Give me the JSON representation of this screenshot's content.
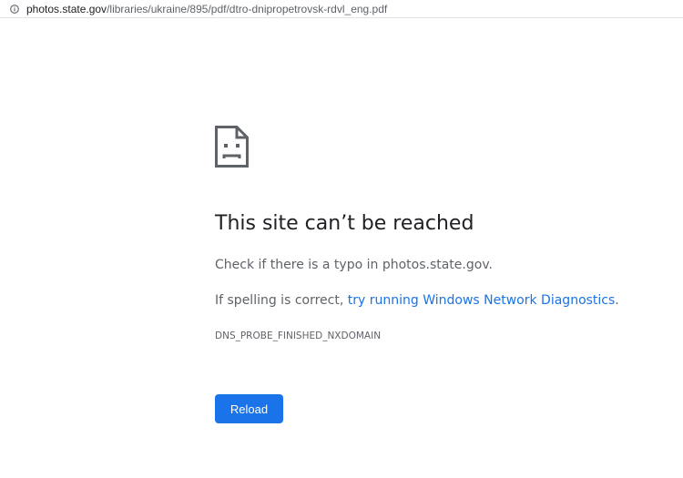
{
  "address_bar": {
    "icon": "info-icon",
    "url_host": "photos.state.gov",
    "url_path": "/libraries/ukraine/895/pdf/dtro-dnipropetrovsk-rdvl_eng.pdf"
  },
  "error_page": {
    "icon": "sad-document-icon",
    "title": "This site can’t be reached",
    "line1": "Check if there is a typo in photos.state.gov.",
    "line2_prefix": "If spelling is correct, ",
    "line2_link": "try running Windows Network Diagnostics",
    "line2_suffix": ".",
    "error_code": "DNS_PROBE_FINISHED_NXDOMAIN",
    "reload_label": "Reload"
  },
  "colors": {
    "link": "#1a73e8",
    "button": "#1a73e8",
    "title": "#202124",
    "body_text": "#5f6368"
  }
}
